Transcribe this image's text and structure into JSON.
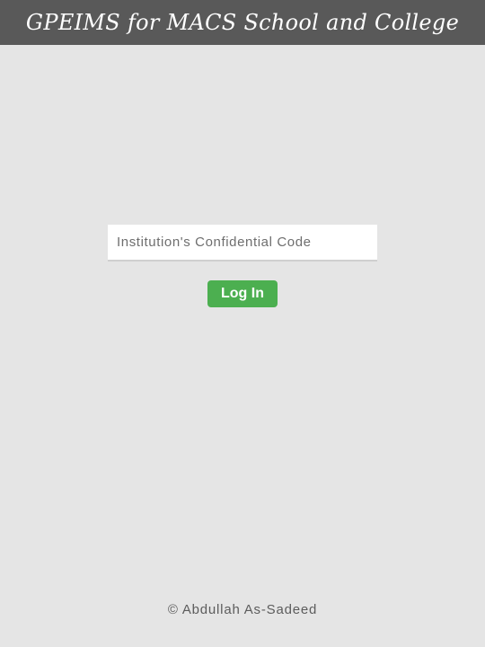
{
  "header": {
    "title": "GPEIMS for MACS School and College"
  },
  "login": {
    "code_field": {
      "value": "",
      "placeholder": "Institution's Confidential Code"
    },
    "submit_label": "Log In"
  },
  "footer": {
    "copyright": "© Abdullah As-Sadeed"
  },
  "colors": {
    "header_background": "#595959",
    "page_background": "#e5e5e5",
    "button_accent": "#4caf50"
  }
}
